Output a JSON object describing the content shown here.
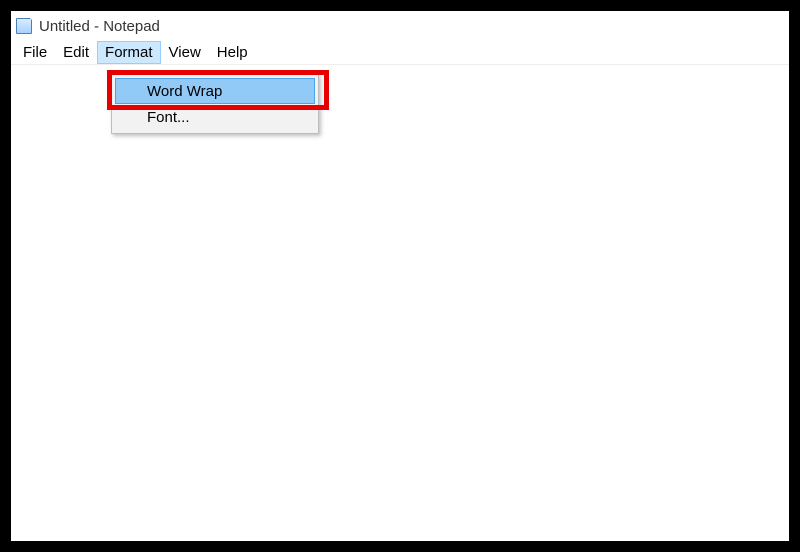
{
  "window": {
    "title": "Untitled - Notepad"
  },
  "menubar": {
    "items": [
      {
        "label": "File"
      },
      {
        "label": "Edit"
      },
      {
        "label": "Format"
      },
      {
        "label": "View"
      },
      {
        "label": "Help"
      }
    ],
    "open_index": 2
  },
  "dropdown": {
    "items": [
      {
        "label": "Word Wrap",
        "highlighted": true
      },
      {
        "label": "Font...",
        "highlighted": false
      }
    ]
  },
  "editor": {
    "content": ""
  },
  "annotation": {
    "color": "#e60000"
  }
}
